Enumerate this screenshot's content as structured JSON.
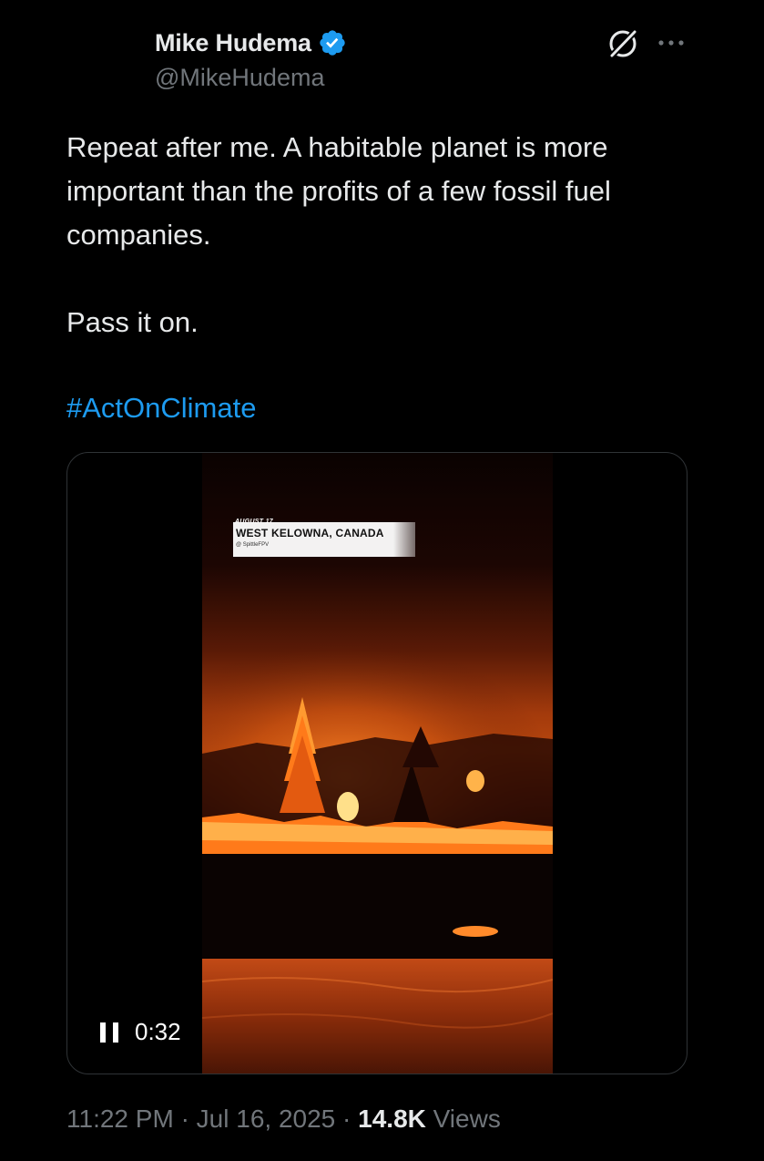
{
  "tweet": {
    "author": {
      "display_name": "Mike Hudema",
      "handle": "@MikeHudema",
      "verified": true,
      "verified_color": "#1d9bf0"
    },
    "icons": {
      "grok": "grok-icon",
      "more": "more-icon"
    },
    "text": {
      "line1": "Repeat after me. A habitable planet is more important than the profits of a few fossil fuel companies.",
      "line2": "Pass it on.",
      "hashtag": "#ActOnClimate"
    },
    "media": {
      "overlay_date": "AUGUST 17",
      "overlay_place": "WEST KELOWNA, CANADA",
      "overlay_credit": "@ SpittleFPV",
      "elapsed": "0:32",
      "state": "playing"
    },
    "meta": {
      "time": "11:22 PM",
      "separator": "·",
      "date": "Jul 16, 2025",
      "views_count": "14.8K",
      "views_label": "Views"
    }
  }
}
